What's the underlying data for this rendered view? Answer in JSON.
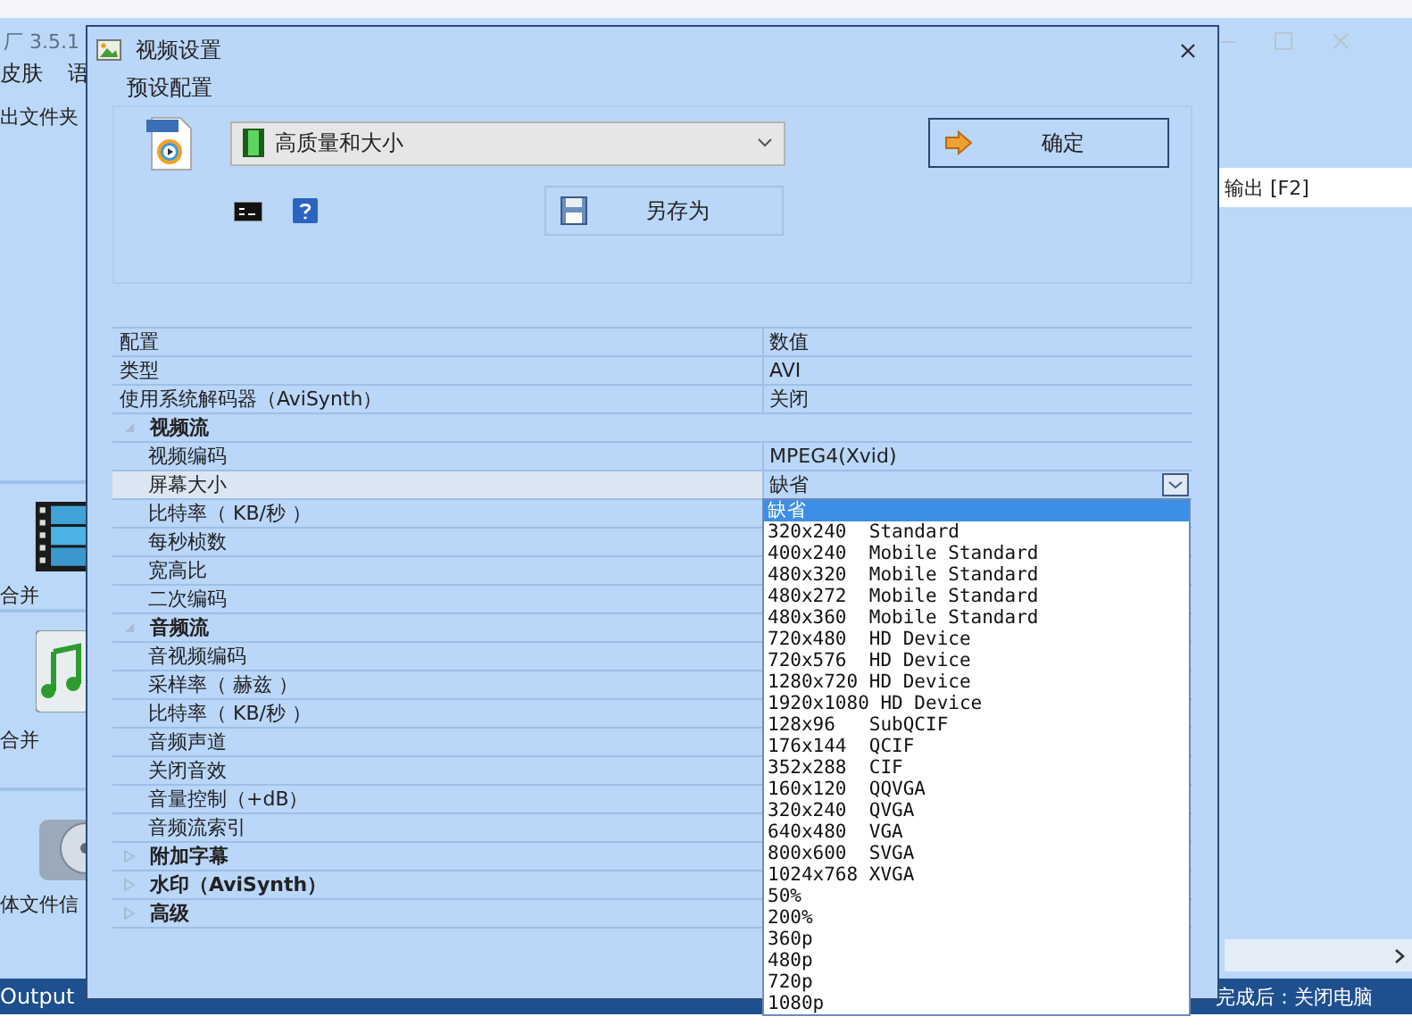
{
  "app": {
    "title": "厂 3.5.1",
    "menu": [
      "皮肤",
      "语"
    ],
    "sidebar_top": "出文件夹",
    "sidebar": [
      {
        "kind": "film",
        "label": "合并"
      },
      {
        "kind": "music",
        "label": "合并"
      },
      {
        "kind": "disc",
        "label": "体文件信"
      }
    ],
    "output_field": "输出 [F2]",
    "status_left": "Output",
    "status_right": "完成后：关闭电脑"
  },
  "dialog": {
    "title": "视频设置",
    "preset_label": "预设配置",
    "preset": "高质量和大小",
    "ok_button": "确定",
    "save_as_button": "另存为"
  },
  "grid": {
    "columns": [
      "配置",
      "数值"
    ],
    "rows": [
      {
        "kind": "property",
        "name": "类型",
        "value": "AVI"
      },
      {
        "kind": "property",
        "name": "使用系统解码器（AviSynth）",
        "value": "关闭"
      },
      {
        "kind": "category",
        "name": "视频流",
        "expanded": true,
        "children": [
          {
            "name": "视频编码",
            "value": "MPEG4(Xvid)",
            "selected": false
          },
          {
            "name": "屏幕大小",
            "value": "缺省",
            "selected": true,
            "dropdown": {
              "open": true,
              "items": [
                {
                  "label": "缺省",
                  "selected": true
                },
                {
                  "label": "320x240  Standard",
                  "selected": false
                },
                {
                  "label": "400x240  Mobile Standard",
                  "selected": false
                },
                {
                  "label": "480x320  Mobile Standard",
                  "selected": false
                },
                {
                  "label": "480x272  Mobile Standard",
                  "selected": false
                },
                {
                  "label": "480x360  Mobile Standard",
                  "selected": false
                },
                {
                  "label": "720x480  HD Device",
                  "selected": false
                },
                {
                  "label": "720x576  HD Device",
                  "selected": false
                },
                {
                  "label": "1280x720 HD Device",
                  "selected": false
                },
                {
                  "label": "1920x1080 HD Device",
                  "selected": false
                },
                {
                  "label": "128x96   SubQCIF",
                  "selected": false
                },
                {
                  "label": "176x144  QCIF",
                  "selected": false
                },
                {
                  "label": "352x288  CIF",
                  "selected": false
                },
                {
                  "label": "160x120  QQVGA",
                  "selected": false
                },
                {
                  "label": "320x240  QVGA",
                  "selected": false
                },
                {
                  "label": "640x480  VGA",
                  "selected": false
                },
                {
                  "label": "800x600  SVGA",
                  "selected": false
                },
                {
                  "label": "1024x768 XVGA",
                  "selected": false
                },
                {
                  "label": "50%",
                  "selected": false
                },
                {
                  "label": "200%",
                  "selected": false
                },
                {
                  "label": "360p",
                  "selected": false
                },
                {
                  "label": "480p",
                  "selected": false
                },
                {
                  "label": "720p",
                  "selected": false
                },
                {
                  "label": "1080p",
                  "selected": false
                }
              ]
            }
          },
          {
            "name": "比特率（ KB/秒 ）",
            "selected": false
          },
          {
            "name": "每秒桢数",
            "selected": false
          },
          {
            "name": "宽高比",
            "selected": false
          },
          {
            "name": "二次编码",
            "selected": false
          }
        ]
      },
      {
        "kind": "category",
        "name": "音频流",
        "expanded": true,
        "children": [
          {
            "name": "音视频编码",
            "selected": false
          },
          {
            "name": "采样率（ 赫兹 ）",
            "selected": false
          },
          {
            "name": "比特率（ KB/秒 ）",
            "selected": false
          },
          {
            "name": "音频声道",
            "selected": false
          },
          {
            "name": "关闭音效",
            "selected": false
          },
          {
            "name": "音量控制（+dB）",
            "selected": false
          },
          {
            "name": "音频流索引",
            "selected": false
          }
        ]
      },
      {
        "kind": "category",
        "name": "附加字幕",
        "expanded": false
      },
      {
        "kind": "category",
        "name": "水印（AviSynth）",
        "expanded": false
      },
      {
        "kind": "category",
        "name": "高级",
        "expanded": false
      }
    ]
  }
}
